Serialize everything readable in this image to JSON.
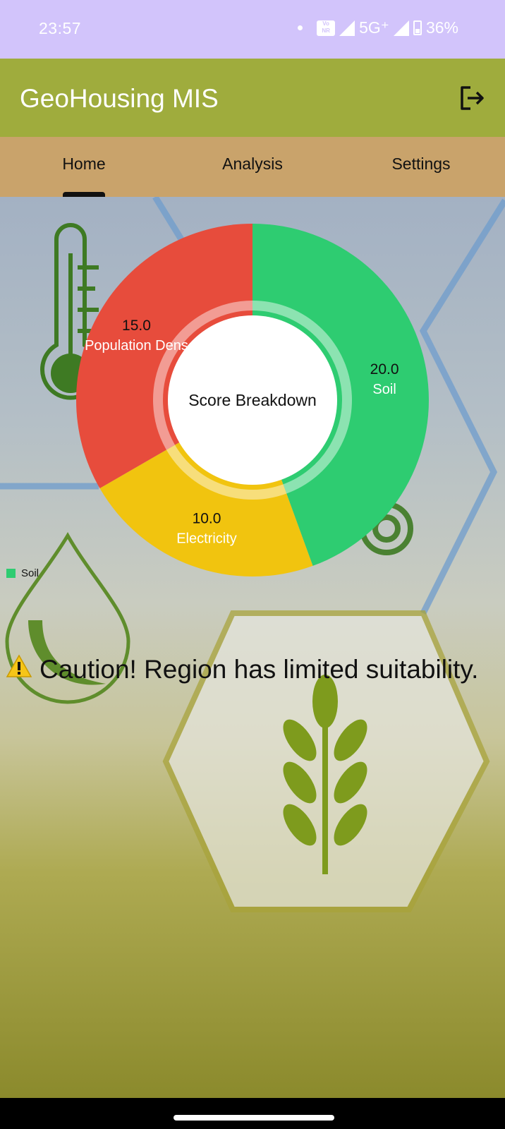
{
  "status_bar": {
    "time": "23:57",
    "network": "5G⁺",
    "battery": "36%",
    "icons": [
      "notification-dot",
      "volte-icon",
      "signal-icon",
      "signal-icon",
      "battery-icon"
    ]
  },
  "app_bar": {
    "title": "GeoHousing MIS",
    "action_icon": "logout-icon"
  },
  "tabs": [
    {
      "label": "Home",
      "selected": true
    },
    {
      "label": "Analysis",
      "selected": false
    },
    {
      "label": "Settings",
      "selected": false
    }
  ],
  "chart_data": {
    "type": "pie",
    "center_text": "Score Breakdown",
    "slices": [
      {
        "label": "Soil",
        "value": 20.0,
        "value_text": "20.0",
        "color": "#2ecc71"
      },
      {
        "label": "Electricity",
        "value": 10.0,
        "value_text": "10.0",
        "color": "#f1c40f"
      },
      {
        "label": "Population Density",
        "display_label": "Population Dens",
        "value": 15.0,
        "value_text": "15.0",
        "color": "#e74c3c"
      }
    ],
    "legend": [
      {
        "label": "Soil",
        "color": "#2ecc71"
      }
    ],
    "legend_placement": "left"
  },
  "alert": {
    "icon": "warning-icon",
    "message": "Caution! Region has limited suitability."
  },
  "colors": {
    "status_bar": "#d2c4fb",
    "app_bar": "#9fac3d",
    "tab_bar": "#c9a36b"
  }
}
